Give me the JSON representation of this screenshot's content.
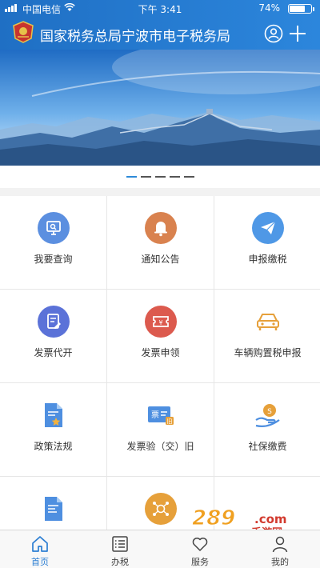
{
  "status_bar": {
    "carrier": "中国电信",
    "time": "下午 3:41",
    "battery_percent": "74%",
    "battery_level": 0.74
  },
  "header": {
    "title": "国家税务总局宁波市电子税务局",
    "icons": [
      "tax-emblem-icon",
      "user-icon",
      "plus-icon"
    ]
  },
  "banner": {
    "slide_count": 5,
    "active_slide": 1
  },
  "services": [
    {
      "label": "我要查询",
      "icon": "query-monitor-icon",
      "color": "#5b8fe0"
    },
    {
      "label": "通知公告",
      "icon": "bell-icon",
      "color": "#d9824f"
    },
    {
      "label": "申报缴税",
      "icon": "paper-plane-icon",
      "color": "#4f98e6"
    },
    {
      "label": "发票代开",
      "icon": "invoice-edit-icon",
      "color": "#5b72d8"
    },
    {
      "label": "发票申领",
      "icon": "ticket-yuan-icon",
      "color": "#dc5a4e"
    },
    {
      "label": "车辆购置税申报",
      "icon": "car-icon",
      "color": "#e6a03a"
    },
    {
      "label": "政策法规",
      "icon": "policy-document-icon",
      "color": "#4e8fe0"
    },
    {
      "label": "发票验（交）旧",
      "icon": "invoice-ticket-icon",
      "color": "#4e8fe0"
    },
    {
      "label": "社保缴费",
      "icon": "social-security-hand-icon",
      "color": "#e6a03a"
    },
    {
      "label": "",
      "icon": "document-list-icon",
      "color": "#4e8fe0"
    },
    {
      "label": "",
      "icon": "network-tax-icon",
      "color": "#e6a03a"
    },
    {
      "label": "",
      "icon": "",
      "color": ""
    }
  ],
  "watermark": {
    "number": "289",
    "domain": ".com",
    "text": "手游网"
  },
  "tabbar": {
    "tabs": [
      {
        "label": "首页",
        "icon": "home-icon",
        "active": true
      },
      {
        "label": "办税",
        "icon": "list-icon",
        "active": false
      },
      {
        "label": "服务",
        "icon": "heart-icon",
        "active": false
      },
      {
        "label": "我的",
        "icon": "person-icon",
        "active": false
      }
    ]
  }
}
